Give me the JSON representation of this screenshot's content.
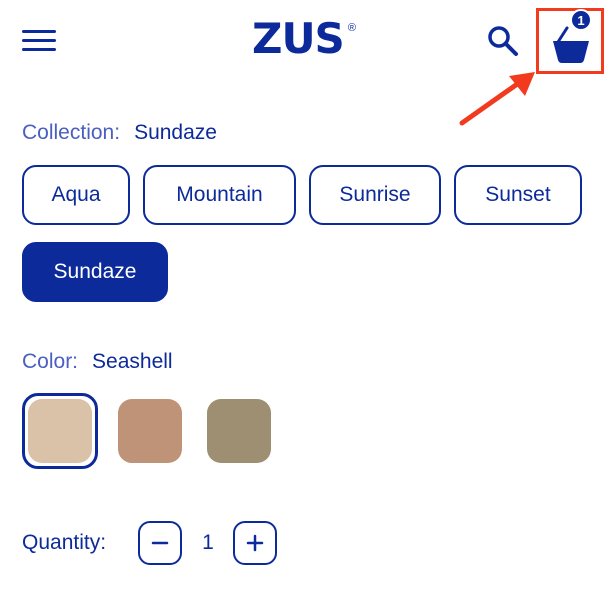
{
  "header": {
    "logo_text": "ZUS",
    "logo_reg": "®",
    "cart_count": "1",
    "brand_color": "#0d2a9a",
    "highlight_color": "#f23a1e"
  },
  "collection": {
    "label": "Collection:",
    "selected": "Sundaze",
    "options": [
      "Aqua",
      "Mountain",
      "Sunrise",
      "Sunset",
      "Sundaze"
    ]
  },
  "color": {
    "label": "Color:",
    "selected": "Seashell",
    "swatches": [
      "#d9c2a7",
      "#bf9377",
      "#9e8f73"
    ]
  },
  "quantity": {
    "label": "Quantity:",
    "value": "1",
    "decrement_icon": "minus-icon",
    "increment_icon": "plus-icon"
  }
}
